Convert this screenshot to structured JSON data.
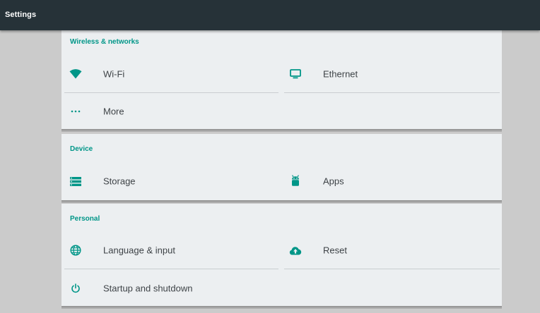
{
  "app": {
    "title": "Settings"
  },
  "sections": {
    "wireless": {
      "title": "Wireless & networks",
      "items": [
        {
          "label": "Wi-Fi",
          "icon": "wifi-icon"
        },
        {
          "label": "Ethernet",
          "icon": "ethernet-icon"
        },
        {
          "label": "More",
          "icon": "more-icon"
        }
      ]
    },
    "device": {
      "title": "Device",
      "items": [
        {
          "label": "Storage",
          "icon": "storage-icon"
        },
        {
          "label": "Apps",
          "icon": "apps-icon"
        }
      ]
    },
    "personal": {
      "title": "Personal",
      "items": [
        {
          "label": "Language & input",
          "icon": "globe-icon"
        },
        {
          "label": "Reset",
          "icon": "cloud-upload-icon"
        },
        {
          "label": "Startup and shutdown",
          "icon": "power-icon"
        }
      ]
    }
  },
  "colors": {
    "accent": "#009688",
    "titlebar": "#263238",
    "panel": "#eceff1",
    "background": "#cbcbcb"
  }
}
